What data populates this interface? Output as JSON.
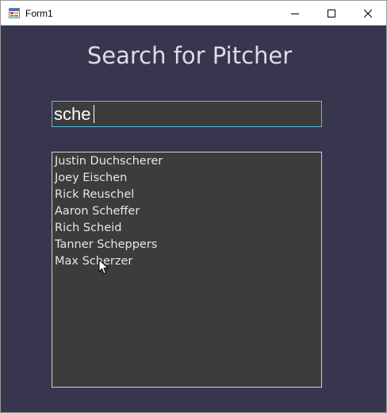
{
  "window": {
    "title": "Form1",
    "buttons": {
      "minimize_icon": "minimize-icon",
      "maximize_icon": "maximize-icon",
      "close_icon": "close-icon"
    }
  },
  "form": {
    "heading": "Search for Pitcher",
    "search": {
      "value": "sche",
      "placeholder": ""
    },
    "results": [
      "Justin Duchscherer",
      "Joey Eischen",
      "Rick Reuschel",
      "Aaron Scheffer",
      "Rich Scheid",
      "Tanner Scheppers",
      "Max Scherzer"
    ]
  },
  "colors": {
    "form_background": "#38354f",
    "control_background": "#3c3c3c",
    "input_focus_border": "#5ab8e6",
    "heading_text": "#dcdce6",
    "list_text": "#e6e6e6"
  }
}
